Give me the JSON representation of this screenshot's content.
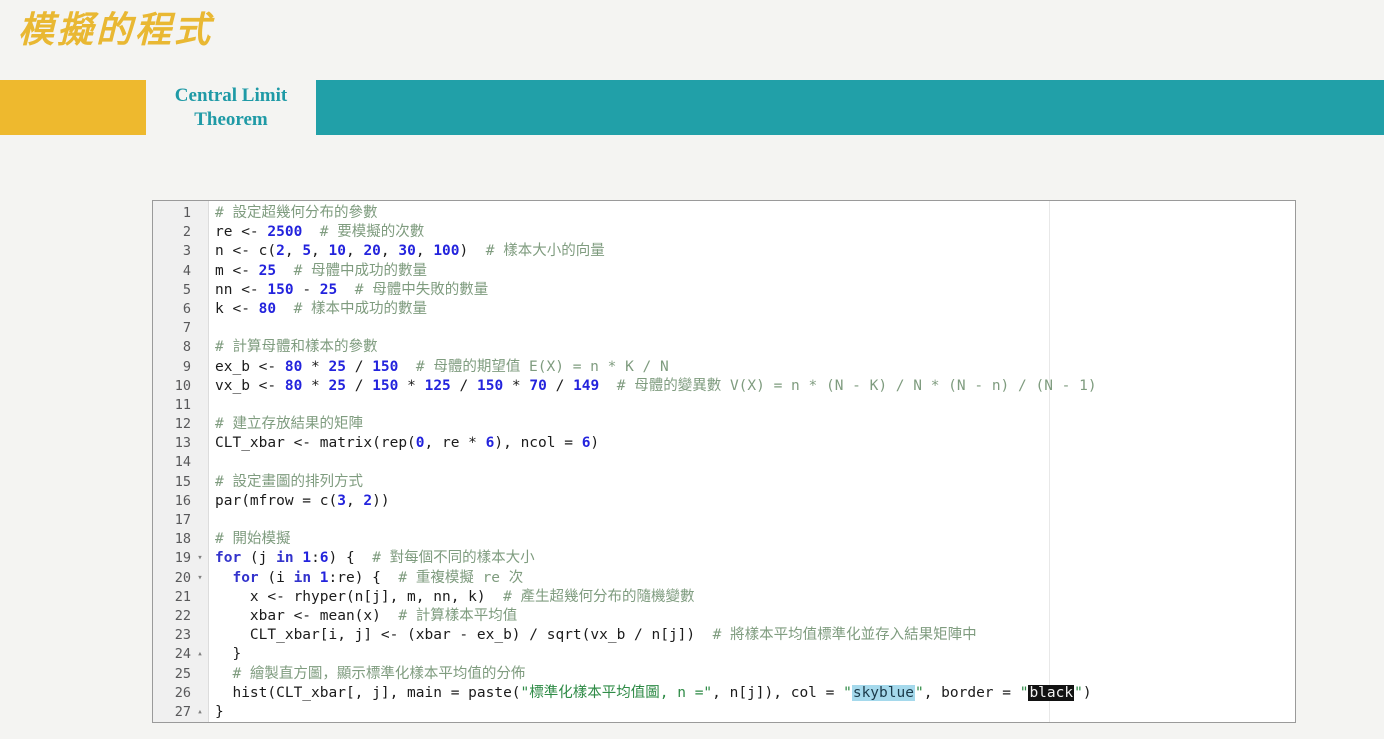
{
  "slide": {
    "title": "模擬的程式",
    "title_color": "#e9b833",
    "background_color": "#f4f4f2"
  },
  "banner": {
    "label_line1": "Central Limit",
    "label_line2": "Theorem",
    "left_block_color": "#eeb92e",
    "right_block_color": "#21a0a8",
    "label_color": "#1f9aa6"
  },
  "editor": {
    "language": "R",
    "colors": {
      "comment": "#7f9c7f",
      "number": "#2323dd",
      "keyword": "#3333cc",
      "string": "#2e8b46",
      "gutter_bg": "#f0f0f0",
      "highlight_skyblue_bg": "#a5d9ec",
      "highlight_black_bg": "#121212"
    },
    "lines": [
      {
        "n": "1",
        "fold": ""
      },
      {
        "n": "2",
        "fold": ""
      },
      {
        "n": "3",
        "fold": ""
      },
      {
        "n": "4",
        "fold": ""
      },
      {
        "n": "5",
        "fold": ""
      },
      {
        "n": "6",
        "fold": ""
      },
      {
        "n": "7",
        "fold": ""
      },
      {
        "n": "8",
        "fold": ""
      },
      {
        "n": "9",
        "fold": ""
      },
      {
        "n": "10",
        "fold": ""
      },
      {
        "n": "11",
        "fold": ""
      },
      {
        "n": "12",
        "fold": ""
      },
      {
        "n": "13",
        "fold": ""
      },
      {
        "n": "14",
        "fold": ""
      },
      {
        "n": "15",
        "fold": ""
      },
      {
        "n": "16",
        "fold": ""
      },
      {
        "n": "17",
        "fold": ""
      },
      {
        "n": "18",
        "fold": ""
      },
      {
        "n": "19",
        "fold": "▾"
      },
      {
        "n": "20",
        "fold": "▾"
      },
      {
        "n": "21",
        "fold": ""
      },
      {
        "n": "22",
        "fold": ""
      },
      {
        "n": "23",
        "fold": ""
      },
      {
        "n": "24",
        "fold": "▴"
      },
      {
        "n": "25",
        "fold": ""
      },
      {
        "n": "26",
        "fold": ""
      },
      {
        "n": "27",
        "fold": "▴"
      }
    ],
    "code_plain": [
      "# 設定超幾何分布的參數",
      "re <- 2500  # 要模擬的次數",
      "n <- c(2, 5, 10, 20, 30, 100)  # 樣本大小的向量",
      "m <- 25  # 母體中成功的數量",
      "nn <- 150 - 25  # 母體中失敗的數量",
      "k <- 80  # 樣本中成功的數量",
      "",
      "# 計算母體和樣本的參數",
      "ex_b <- 80 * 25 / 150  # 母體的期望值 E(X) = n * K / N",
      "vx_b <- 80 * 25 / 150 * 125 / 150 * 70 / 149  # 母體的變異數 V(X) = n * (N - K) / N * (N - n) / (N - 1)",
      "",
      "# 建立存放結果的矩陣",
      "CLT_xbar <- matrix(rep(0, re * 6), ncol = 6)",
      "",
      "# 設定畫圖的排列方式",
      "par(mfrow = c(3, 2))",
      "",
      "# 開始模擬",
      "for (j in 1:6) {  # 對每個不同的樣本大小",
      "  for (i in 1:re) {  # 重複模擬 re 次",
      "    x <- rhyper(n[j], m, nn, k)  # 產生超幾何分布的隨機變數",
      "    xbar <- mean(x)  # 計算樣本平均值",
      "    CLT_xbar[i, j] <- (xbar - ex_b) / sqrt(vx_b / n[j])  # 將樣本平均值標準化並存入結果矩陣中",
      "  }",
      "  # 繪製直方圖，顯示標準化樣本平均值的分佈",
      "  hist(CLT_xbar[, j], main = paste(\"標準化樣本平均值圖, n =\", n[j]), col = \"skyblue\", border = \"black\")",
      "}"
    ],
    "highlighted_values": [
      "skyblue",
      "black"
    ]
  }
}
